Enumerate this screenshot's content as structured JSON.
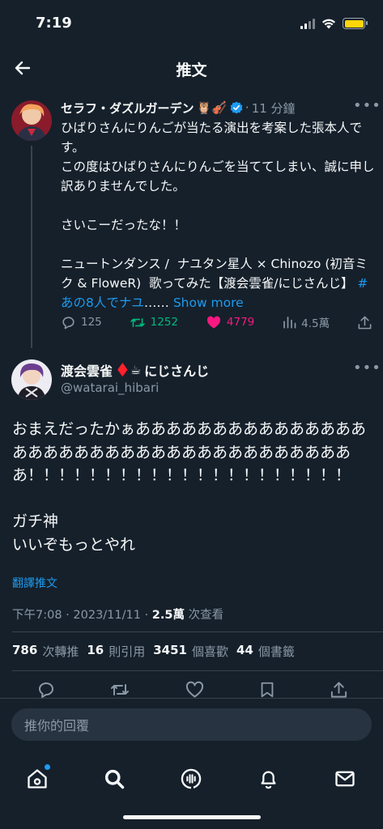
{
  "status_bar": {
    "time": "7:19"
  },
  "header": {
    "title": "推文"
  },
  "parent_tweet": {
    "name": "セラフ・ダズルガーデン",
    "badges": "🦉🎻",
    "dot": "·",
    "time_ago": "11 分鐘",
    "text": "ひばりさんにりんごが当たる演出を考案した張本人です。\nこの度はひばりさんにりんごを当ててしまい、誠に申し訳ありませんでした。\n\nさいこーだったな！！\n\nニュートンダンス /  ナユタン星人 × Chinozo (初音ミク & FloweR)  歌ってみた【渡会雲雀/にじさんじ】 ",
    "hashtag": "#あの8人でナユ",
    "ellipsis": "……",
    "show_more": "Show more",
    "replies": "125",
    "retweets": "1252",
    "likes": "4779",
    "views": "4.5萬"
  },
  "main_tweet": {
    "name": "渡会雲雀",
    "badges": "♦️☕",
    "org": "にじさんじ",
    "handle": "@watarai_hibari",
    "text": "おまえだったかぁああああああああああああああああああああああああああああああああああああああ！！！！！！！！！！！！！！！！！！！！！\n\nガチ神\nいいぞもっとやれ",
    "translate": "翻譯推文",
    "meta_time": "下午7:08 · 2023/11/11 · ",
    "views_count": "2.5萬",
    "views_label": " 次查看",
    "stats": [
      {
        "count": "786",
        "label": "次轉推"
      },
      {
        "count": "16",
        "label": "則引用"
      },
      {
        "count": "3451",
        "label": "個喜歡"
      },
      {
        "count": "44",
        "label": "個書籤"
      }
    ]
  },
  "reply": {
    "placeholder": "推你的回覆"
  },
  "colors": {
    "background": "#15202b",
    "accent": "#1d9bf0",
    "like": "#f91880",
    "retweet": "#00ba7c",
    "muted": "#8b98a5"
  }
}
